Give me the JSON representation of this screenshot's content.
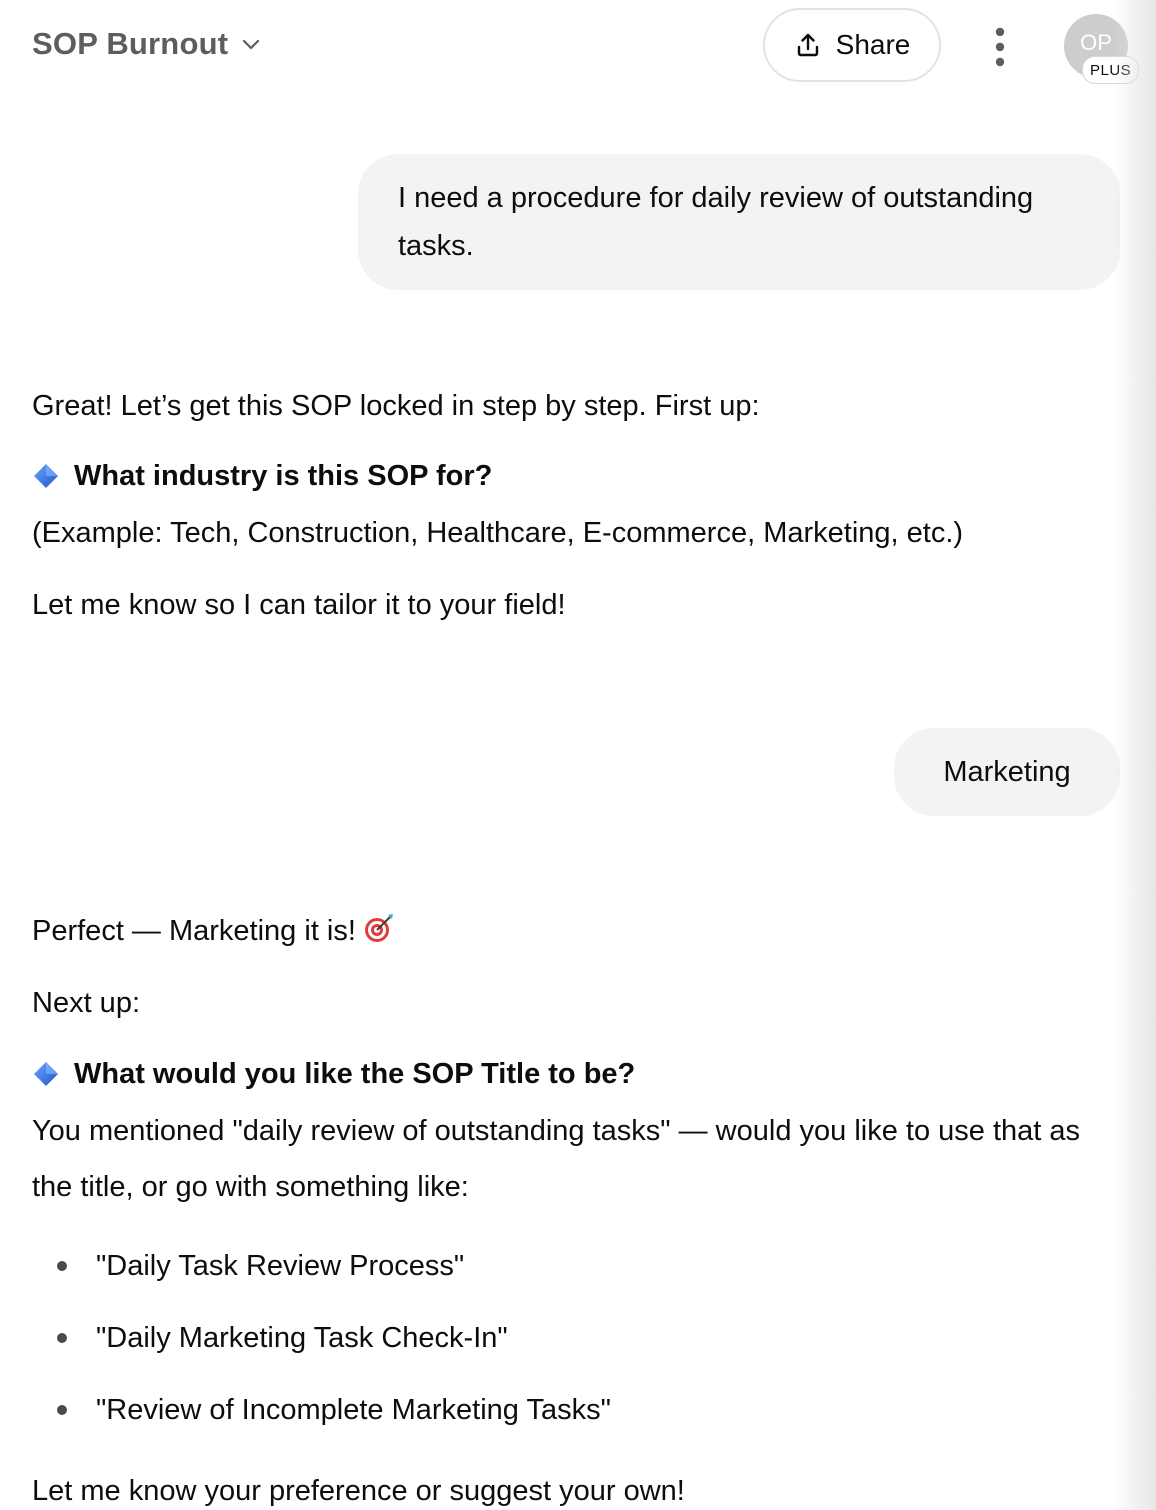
{
  "header": {
    "title": "SOP Burnout",
    "share_label": "Share",
    "avatar_initials": "OP",
    "plan_badge": "PLUS"
  },
  "messages": {
    "user_1": "I need a procedure for daily review of outstanding tasks.",
    "assistant_1": {
      "intro": "Great! Let’s get this SOP locked in step by step. First up:",
      "question": "What industry is this SOP for?",
      "example": "(Example: Tech, Construction, Healthcare, E-commerce, Marketing, etc.)",
      "closing": "Let me know so I can tailor it to your field!"
    },
    "user_2": "Marketing",
    "assistant_2": {
      "intro": "Perfect — Marketing it is!",
      "next": "Next up:",
      "question": "What would you like the SOP Title to be?",
      "body": "You mentioned \"daily review of outstanding tasks\" — would you like to use that as the title, or go with something like:",
      "options": [
        "\"Daily Task Review Process\"",
        "\"Daily Marketing Task Check-In\"",
        "\"Review of Incomplete Marketing Tasks\""
      ],
      "closing": "Let me know your preference or suggest your own!"
    }
  },
  "icons": {
    "title_dropdown": "chevron-down-icon",
    "share": "upload-icon",
    "more": "vertical-ellipsis-icon",
    "question_marker": "blue-diamond-icon",
    "emoji": "direct-hit-target-icon"
  },
  "colors": {
    "bubble_bg": "#f3f3f3",
    "title_color": "#5d5d5d",
    "avatar_bg": "#cdcdcd",
    "diamond_blue": "#2f6fe0"
  }
}
